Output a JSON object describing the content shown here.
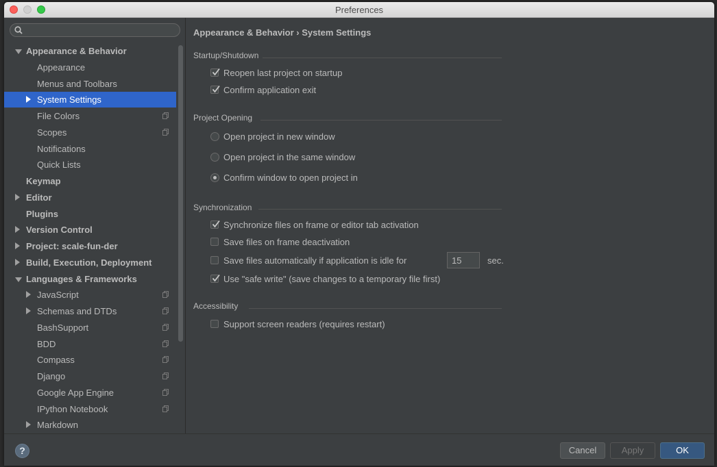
{
  "window": {
    "title": "Preferences"
  },
  "search": {
    "placeholder": ""
  },
  "tree": [
    {
      "label": "Appearance & Behavior",
      "level": 0,
      "expanded": true,
      "bold": true
    },
    {
      "label": "Appearance",
      "level": 1
    },
    {
      "label": "Menus and Toolbars",
      "level": 1
    },
    {
      "label": "System Settings",
      "level": 1,
      "collapsed": true,
      "selected": true
    },
    {
      "label": "File Colors",
      "level": 1,
      "copy": true
    },
    {
      "label": "Scopes",
      "level": 1,
      "copy": true
    },
    {
      "label": "Notifications",
      "level": 1
    },
    {
      "label": "Quick Lists",
      "level": 1
    },
    {
      "label": "Keymap",
      "level": 0,
      "bold": true
    },
    {
      "label": "Editor",
      "level": 0,
      "collapsed": true,
      "bold": true
    },
    {
      "label": "Plugins",
      "level": 0,
      "bold": true
    },
    {
      "label": "Version Control",
      "level": 0,
      "collapsed": true,
      "bold": true
    },
    {
      "label": "Project: scale-fun-der",
      "level": 0,
      "collapsed": true,
      "bold": true
    },
    {
      "label": "Build, Execution, Deployment",
      "level": 0,
      "collapsed": true,
      "bold": true
    },
    {
      "label": "Languages & Frameworks",
      "level": 0,
      "expanded": true,
      "bold": true
    },
    {
      "label": "JavaScript",
      "level": 1,
      "collapsed": true,
      "copy": true
    },
    {
      "label": "Schemas and DTDs",
      "level": 1,
      "collapsed": true,
      "copy": true
    },
    {
      "label": "BashSupport",
      "level": 1,
      "copy": true
    },
    {
      "label": "BDD",
      "level": 1,
      "copy": true
    },
    {
      "label": "Compass",
      "level": 1,
      "copy": true
    },
    {
      "label": "Django",
      "level": 1,
      "copy": true
    },
    {
      "label": "Google App Engine",
      "level": 1,
      "copy": true
    },
    {
      "label": "IPython Notebook",
      "level": 1,
      "copy": true
    },
    {
      "label": "Markdown",
      "level": 1,
      "collapsed": true
    }
  ],
  "main": {
    "breadcrumb": "Appearance & Behavior › System Settings",
    "startup": {
      "title": "Startup/Shutdown",
      "reopen_label": "Reopen last project on startup",
      "reopen_checked": true,
      "confirm_exit_label": "Confirm application exit",
      "confirm_exit_checked": true
    },
    "project_opening": {
      "title": "Project Opening",
      "new_window_label": "Open project in new window",
      "same_window_label": "Open project in the same window",
      "confirm_window_label": "Confirm window to open project in",
      "selected": "confirm_window"
    },
    "sync": {
      "title": "Synchronization",
      "sync_files_label": "Synchronize files on frame or editor tab activation",
      "sync_files_checked": true,
      "save_deactivation_label": "Save files on frame deactivation",
      "save_deactivation_checked": false,
      "save_idle_label": "Save files automatically if application is idle for",
      "save_idle_checked": false,
      "idle_value": "15",
      "idle_unit": "sec.",
      "safe_write_label": "Use \"safe write\" (save changes to a temporary file first)",
      "safe_write_checked": true
    },
    "accessibility": {
      "title": "Accessibility",
      "screen_readers_label": "Support screen readers (requires restart)",
      "screen_readers_checked": false
    }
  },
  "buttons": {
    "cancel": "Cancel",
    "apply": "Apply",
    "ok": "OK",
    "help": "?"
  },
  "colors": {
    "selection": "#2f65ca",
    "background": "#3c3f41",
    "ok_button": "#365880"
  }
}
